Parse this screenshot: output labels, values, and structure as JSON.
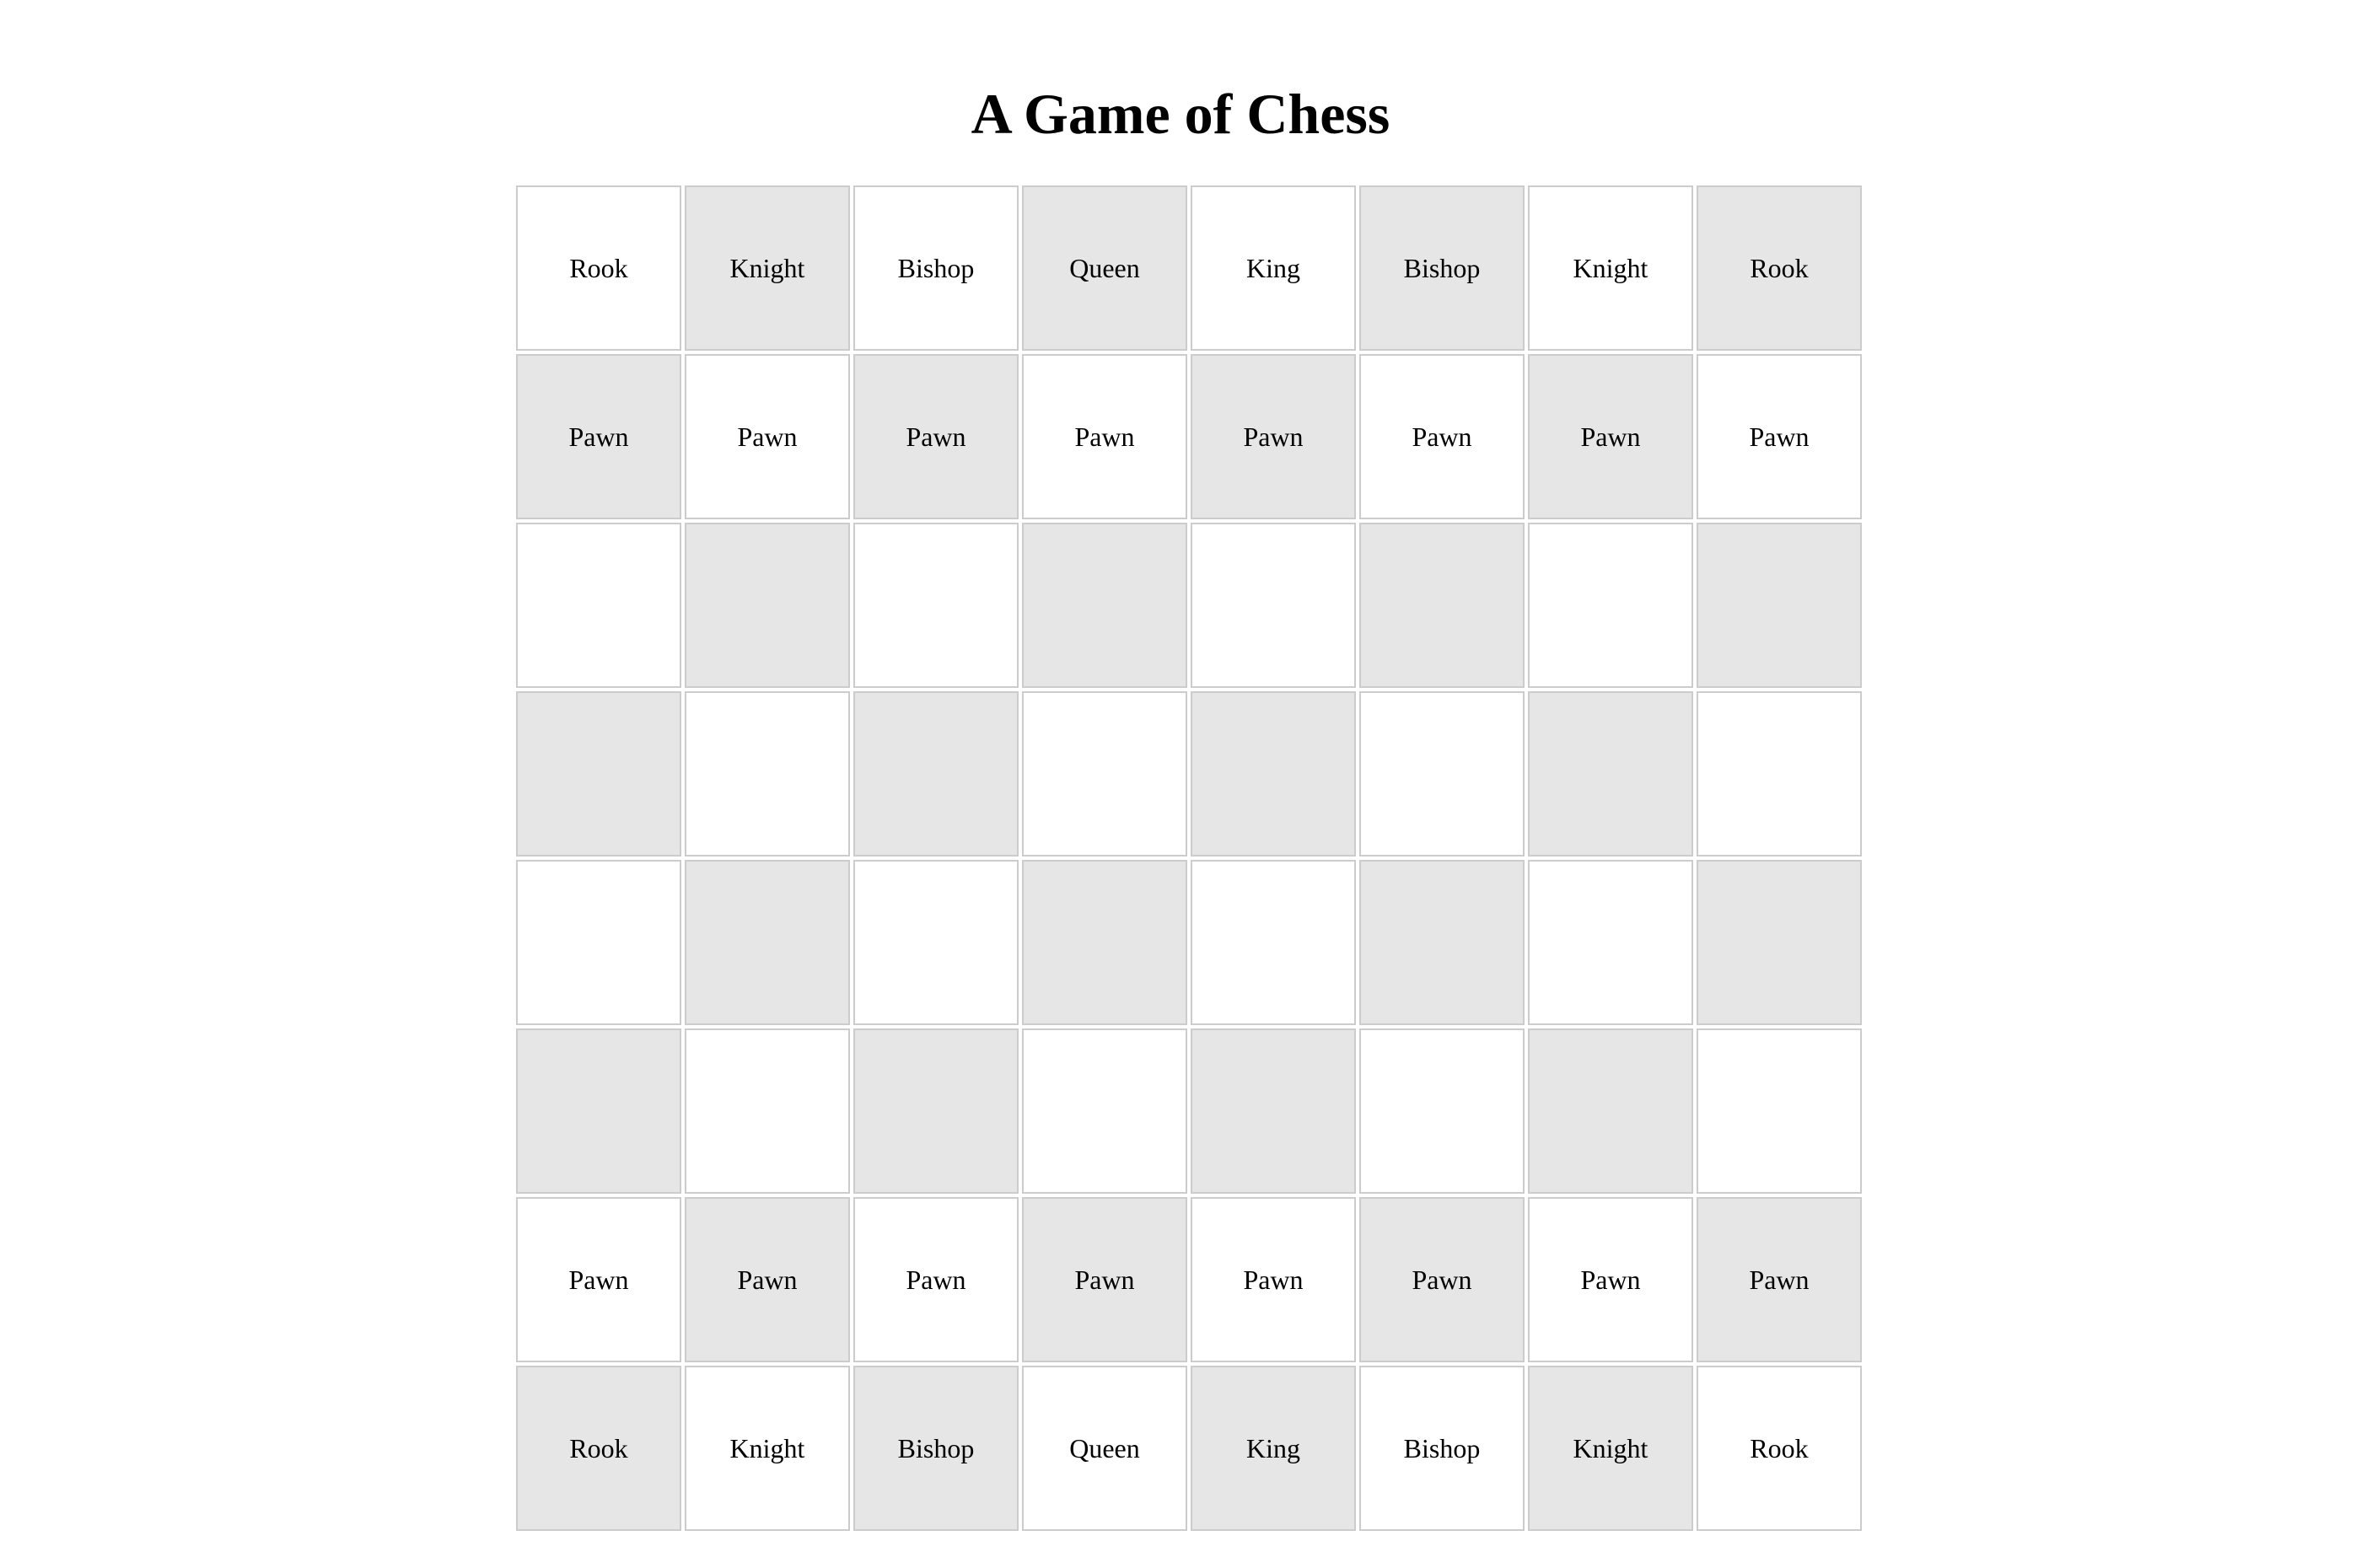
{
  "title": "A Game of Chess",
  "colors": {
    "light_square": "#ffffff",
    "dark_square": "#e6e6e6",
    "square_border": "#cccccc"
  },
  "board": [
    [
      "Rook",
      "Knight",
      "Bishop",
      "Queen",
      "King",
      "Bishop",
      "Knight",
      "Rook"
    ],
    [
      "Pawn",
      "Pawn",
      "Pawn",
      "Pawn",
      "Pawn",
      "Pawn",
      "Pawn",
      "Pawn"
    ],
    [
      "",
      "",
      "",
      "",
      "",
      "",
      "",
      ""
    ],
    [
      "",
      "",
      "",
      "",
      "",
      "",
      "",
      ""
    ],
    [
      "",
      "",
      "",
      "",
      "",
      "",
      "",
      ""
    ],
    [
      "",
      "",
      "",
      "",
      "",
      "",
      "",
      ""
    ],
    [
      "Pawn",
      "Pawn",
      "Pawn",
      "Pawn",
      "Pawn",
      "Pawn",
      "Pawn",
      "Pawn"
    ],
    [
      "Rook",
      "Knight",
      "Bishop",
      "Queen",
      "King",
      "Bishop",
      "Knight",
      "Rook"
    ]
  ]
}
